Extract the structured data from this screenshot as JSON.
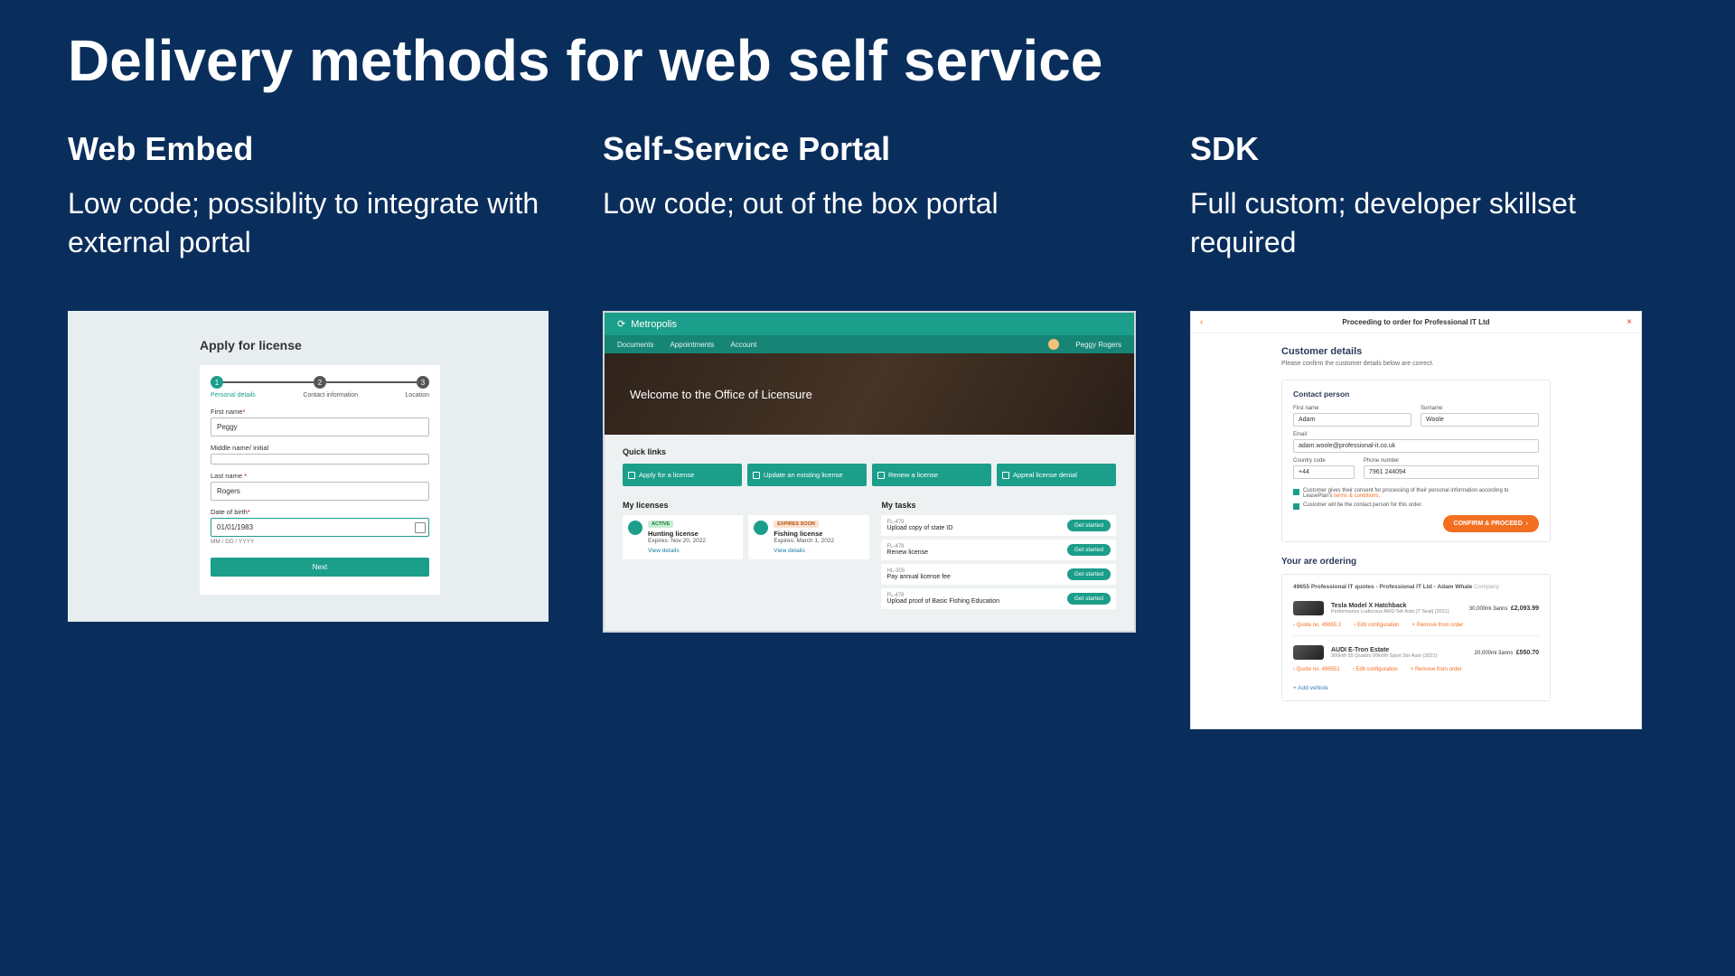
{
  "title": "Delivery methods for web self service",
  "columns": {
    "embed": {
      "heading": "Web Embed",
      "sub": "Low code; possiblity to integrate with external portal"
    },
    "portal": {
      "heading": "Self-Service Portal",
      "sub": "Low code; out of the box portal"
    },
    "sdk": {
      "heading": "SDK",
      "sub": "Full custom; developer skillset required"
    }
  },
  "embed": {
    "title": "Apply for license",
    "steps": [
      "Personal details",
      "Contact information",
      "Location"
    ],
    "first_name_label": "First name",
    "first_name_value": "Peggy",
    "middle_label": "Middle name/ initial",
    "middle_value": "",
    "last_name_label": "Last name",
    "last_name_value": "Rogers",
    "dob_label": "Date of birth",
    "dob_value": "01/01/1983",
    "dob_hint": "MM / DD / YYYY",
    "next": "Next",
    "required_mark": "*"
  },
  "portal": {
    "brand": "Metropolis",
    "nav": [
      "Documents",
      "Appointments",
      "Account"
    ],
    "user": "Peggy Rogers",
    "hero": "Welcome to the Office of Licensure",
    "quick_links_title": "Quick links",
    "quick_links": [
      "Apply for a license",
      "Update an existing license",
      "Renew a license",
      "Appeal license denial"
    ],
    "my_licenses_title": "My licenses",
    "licenses": [
      {
        "badge": "ACTIVE",
        "name": "Hunting license",
        "expires": "Expires: Nov 20, 2022",
        "link": "View details"
      },
      {
        "badge": "EXPIRES SOON",
        "name": "Fishing license",
        "expires": "Expires: March 1, 2022",
        "link": "View details"
      }
    ],
    "my_tasks_title": "My tasks",
    "task_button": "Get started",
    "tasks": [
      {
        "id": "FL-479",
        "text": "Upload copy of state ID"
      },
      {
        "id": "FL-478",
        "text": "Renew license"
      },
      {
        "id": "HL-305",
        "text": "Pay annual license fee"
      },
      {
        "id": "FL-478",
        "text": "Upload proof of Basic Fishing Education"
      }
    ]
  },
  "sdk": {
    "header": "Proceeding to order for Professional IT Ltd",
    "h2": "Customer details",
    "sub": "Please confirm the customer details below are correct.",
    "contact_title": "Contact person",
    "fn_label": "First name",
    "fn_value": "Adam",
    "sn_label": "Surname",
    "sn_value": "Woole",
    "email_label": "Email",
    "email_value": "adam.woole@professional-it.co.uk",
    "cc_label": "Country code",
    "cc_value": "+44",
    "phone_label": "Phone number",
    "phone_value": "7961 244094",
    "consent1_a": "Customer gives their consent for processing of their personal information according to LeasePlan's ",
    "consent1_b": "terms & conditions.",
    "consent2": "Customer will be the contact person for this order.",
    "confirm": "CONFIRM & PROCEED",
    "ordering_title": "Your are ordering",
    "quote_header": "49655 Professional IT quotes - Professional IT Ltd - Adam Whale ",
    "quote_company": "Company",
    "vehicles": [
      {
        "name": "Tesla Model X Hatchback",
        "sub": "Performance Ludicrous AWD 5dr Auto [7 Seat] (2021)",
        "term": "30,000mi 3anns",
        "price": "£2,093.99",
        "quote_no": "Quote no. 49655.2",
        "edit": "Edit configuration",
        "remove": "Remove from order"
      },
      {
        "name": "AUDI E-Tron Estate",
        "sub": "300kW 55 Quattro 95kWh Sport 5dr Auto (2021)",
        "term": "20,000mi 3anns",
        "price": "£550.70",
        "quote_no": "Quote no. 496551",
        "edit": "Edit configuration",
        "remove": "Remove from order"
      }
    ],
    "add_vehicle": "Add vehicle"
  }
}
